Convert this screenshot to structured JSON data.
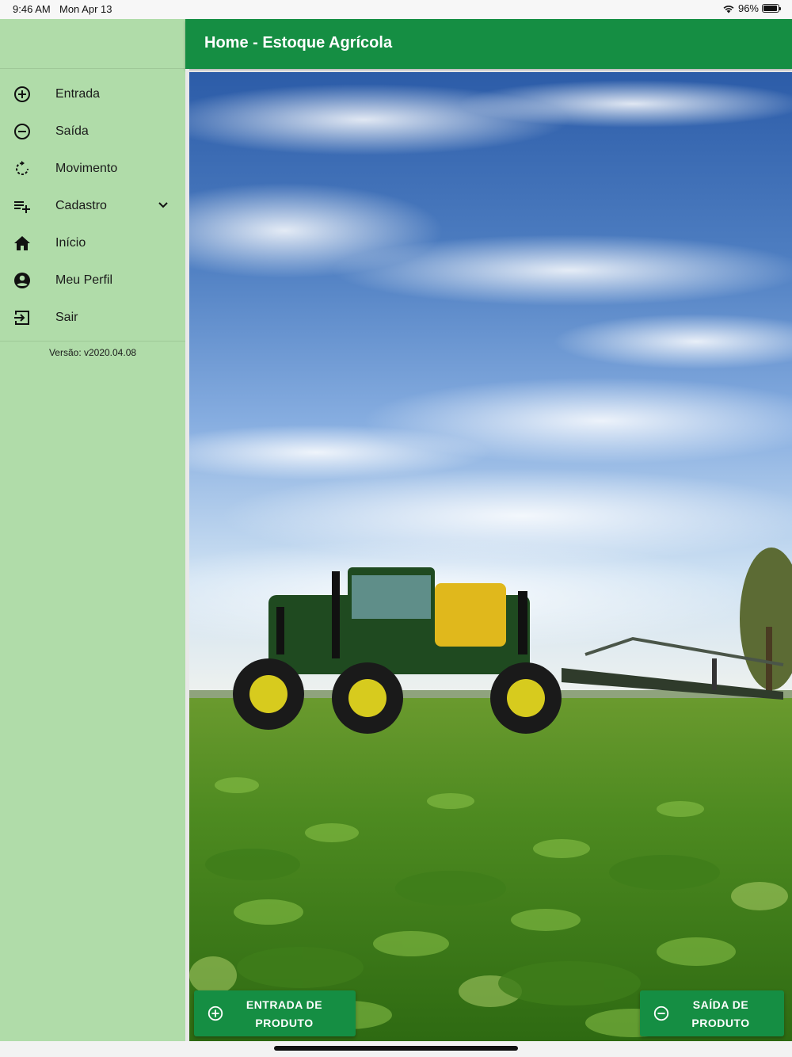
{
  "status_bar": {
    "time": "9:46 AM",
    "date": "Mon Apr 13",
    "battery": "96%"
  },
  "app_bar": {
    "title": "Home - Estoque Agrícola"
  },
  "drawer": {
    "items": [
      {
        "label": "Entrada",
        "icon": "add-circle-icon"
      },
      {
        "label": "Saída",
        "icon": "remove-circle-icon"
      },
      {
        "label": "Movimento",
        "icon": "refresh-icon"
      },
      {
        "label": "Cadastro",
        "icon": "playlist-add-icon"
      },
      {
        "label": "Início",
        "icon": "home-icon"
      },
      {
        "label": "Meu Perfil",
        "icon": "account-circle-icon"
      },
      {
        "label": "Sair",
        "icon": "exit-icon"
      }
    ],
    "version": "Versão: v2020.04.08"
  },
  "actions": {
    "entrada_line1": "ENTRADA DE",
    "entrada_line2": "PRODUTO",
    "saida_line1": "SAÍDA DE",
    "saida_line2": "PRODUTO"
  },
  "colors": {
    "primary": "#158e43",
    "drawer": "#b0dca9"
  }
}
